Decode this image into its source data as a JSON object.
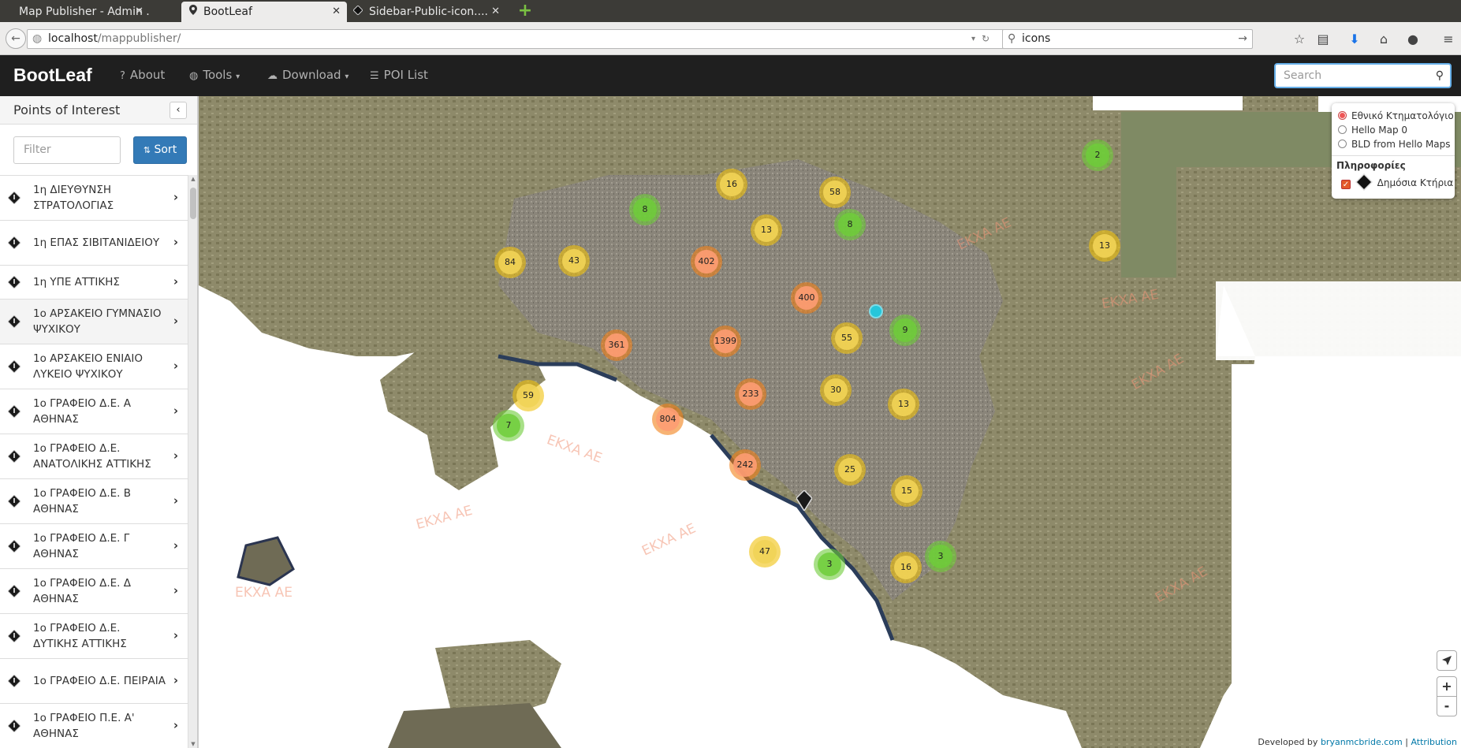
{
  "browser": {
    "tabs": [
      {
        "title": "Map Publisher - Admin ...",
        "active": false
      },
      {
        "title": "BootLeaf",
        "active": true
      },
      {
        "title": "Sidebar-Public-icon....",
        "active": false
      }
    ],
    "close_glyph": "✕",
    "new_tab_glyph": "+",
    "url_host": "localhost",
    "url_path": "/mappublisher/",
    "search_value": "icons"
  },
  "app": {
    "brand": "BootLeaf",
    "nav": [
      {
        "label": "About",
        "icon": "question-circle-icon"
      },
      {
        "label": "Tools",
        "icon": "globe-icon",
        "dropdown": true
      },
      {
        "label": "Download",
        "icon": "cloud-download-icon",
        "dropdown": true
      },
      {
        "label": "POI List",
        "icon": "list-icon"
      }
    ],
    "search_placeholder": "Search"
  },
  "sidebar": {
    "title": "Points of Interest",
    "filter_placeholder": "Filter",
    "sort_label": "Sort",
    "items": [
      "1η ΔΙΕΥΘΥΝΣΗ ΣΤΡΑΤΟΛΟΓΙΑΣ",
      "1η ΕΠΑΣ ΣΙΒΙΤΑΝΙΔΕΙΟΥ",
      "1η ΥΠΕ ΑΤΤΙΚΗΣ",
      "1ο ΑΡΣΑΚΕΙΟ ΓΥΜΝΑΣΙΟ ΨΥΧΙΚΟΥ",
      "1ο ΑΡΣΑΚΕΙΟ ΕΝΙΑΙΟ ΛΥΚΕΙΟ ΨΥΧΙΚΟΥ",
      "1ο ΓΡΑΦΕΙΟ Δ.Ε. Α ΑΘΗΝΑΣ",
      "1ο ΓΡΑΦΕΙΟ Δ.Ε. ΑΝΑΤΟΛΙΚΗΣ ΑΤΤΙΚΗΣ",
      "1ο ΓΡΑΦΕΙΟ Δ.Ε. Β ΑΘΗΝΑΣ",
      "1ο ΓΡΑΦΕΙΟ Δ.Ε. Γ ΑΘΗΝΑΣ",
      "1ο ΓΡΑΦΕΙΟ Δ.Ε. Δ ΑΘΗΝΑΣ",
      "1ο ΓΡΑΦΕΙΟ Δ.Ε. ΔΥΤΙΚΗΣ ΑΤΤΙΚΗΣ",
      "1ο ΓΡΑΦΕΙΟ Δ.Ε. ΠΕΙΡΑΙΑ",
      "1ο ΓΡΑΦΕΙΟ Π.Ε. Α' ΑΘΗΝΑΣ"
    ],
    "highlighted_index": 3
  },
  "map": {
    "clusters": [
      "2",
      "16",
      "58",
      "8",
      "13",
      "8",
      "13",
      "84",
      "43",
      "402",
      "400",
      "361",
      "1399",
      "55",
      "9",
      "59",
      "233",
      "30",
      "13",
      "7",
      "804",
      "242",
      "25",
      "15",
      "47",
      "3",
      "16",
      "3"
    ],
    "watermark": "ΕΚΧΑ ΑΕ",
    "layers": {
      "base": [
        {
          "label": "Εθνικό Κτηματολόγιο",
          "selected": true
        },
        {
          "label": "Hello Map 0",
          "selected": false
        },
        {
          "label": "BLD from Hello Maps",
          "selected": false
        }
      ],
      "overlay_header": "Πληροφορίες",
      "overlay": {
        "label": "Δημόσια Κτήρια",
        "checked": true
      }
    },
    "zoom_in": "+",
    "zoom_out": "-",
    "attribution_prefix": "Developed by ",
    "attribution_link": "bryanmcbride.com",
    "attribution_sep": " | ",
    "attribution_label": "Attribution"
  },
  "colors": {
    "cluster_small": "#6ecc39",
    "cluster_medium": "#f0c20c",
    "cluster_large": "#f18017",
    "primary": "#337ab7"
  }
}
